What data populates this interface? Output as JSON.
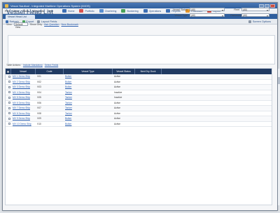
{
  "window": {
    "title": "Veson Nautical - Integrated Maritime Operations System (IMOS)"
  },
  "menu": [
    "File",
    "View",
    "Tools",
    "Windows",
    "Help"
  ],
  "toolbar": [
    {
      "label": "Home",
      "color": "#3d6fb4"
    },
    {
      "label": "Portfolio",
      "color": "#d9534f"
    },
    {
      "label": "Chartering",
      "color": "#5a8fd0"
    },
    {
      "label": "Bunkering",
      "color": "#4aa35a"
    },
    {
      "label": "Operations",
      "color": "#3d6fb4"
    },
    {
      "label": "Reports",
      "color": "#3d6fb4"
    },
    {
      "label": "Financials",
      "color": "#e3962b"
    },
    {
      "label": "Layout",
      "color": "#c9463d"
    }
  ],
  "tab": {
    "label": "Vessel Head List"
  },
  "actions": {
    "refresh": "Refresh",
    "export": "Export",
    "layout": "Layout Fields",
    "screen_options": "Screen Options"
  },
  "page": {
    "title": "Vessel Head List",
    "view_label": "View",
    "view_value": "Default View",
    "show_label": "Show Only",
    "show_link": "Ask Question",
    "new_link": "New Bookmark"
  },
  "filters": {
    "vessel_status": {
      "label": "Vessel Status",
      "value": "(All)"
    },
    "vessel_type": {
      "label": "Vessel Type",
      "value": "(All)"
    },
    "fleet": {
      "label": "Fleet",
      "value": "(All)"
    },
    "ownership": {
      "label": "Ownership",
      "value": "(All)"
    }
  },
  "table_links": {
    "prefix": "Table Actions:",
    "link1": "Include Mandatory",
    "link2": "Select Fields"
  },
  "columns": [
    "",
    "Vessel",
    "Code",
    "Vessel Type",
    "Vessel Status",
    "Next Dry Dock"
  ],
  "rows": [
    {
      "vessel": "MV 1 Demo Ship",
      "code": "V01",
      "type": "Bulker",
      "status": "Active"
    },
    {
      "vessel": "MV 2 Demo Ship",
      "code": "V02",
      "type": "Bulker",
      "status": "Active"
    },
    {
      "vessel": "MV 3 Demo Ship",
      "code": "V03",
      "type": "Bulker",
      "status": "Active"
    },
    {
      "vessel": "MV 4 Demo Ship",
      "code": "V04",
      "type": "Tanker",
      "status": "Inactive"
    },
    {
      "vessel": "MV 5 Demo Ship",
      "code": "V05",
      "type": "Tanker",
      "status": "Inactive"
    },
    {
      "vessel": "MV 6 Demo Ship",
      "code": "V06",
      "type": "Tanker",
      "status": "Active"
    },
    {
      "vessel": "MV 7 Demo Ship",
      "code": "V07",
      "type": "Tanker",
      "status": "Active"
    },
    {
      "vessel": "MV 8 Demo Ship",
      "code": "V08",
      "type": "Tanker",
      "status": "Active"
    },
    {
      "vessel": "MV 9 Demo Ship",
      "code": "V09",
      "type": "Bulker",
      "status": "Active"
    },
    {
      "vessel": "MV 10 Demo Ship",
      "code": "V10",
      "type": "Bulker",
      "status": "Active"
    }
  ]
}
